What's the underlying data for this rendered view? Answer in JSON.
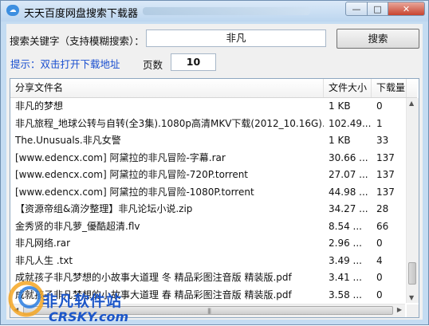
{
  "window": {
    "title": "天天百度网盘搜索下载器",
    "controls": {
      "minimize": "—",
      "maximize": "□",
      "close": "✕"
    }
  },
  "search": {
    "label": "搜索关键字（支持模糊搜索）：",
    "value": "非凡",
    "button": "搜索"
  },
  "hint": "提示：双击打开下载地址",
  "pages": {
    "label": "页数",
    "value": "10"
  },
  "table": {
    "columns": [
      "分享文件名",
      "文件大小",
      "下载量"
    ],
    "rows": [
      [
        "非凡的梦想",
        "1 KB",
        "0"
      ],
      [
        "非凡旅程_地球公转与自转(全3集).1080p高清MKV下载(2012_10.16G)...",
        "102.49...",
        "1"
      ],
      [
        "The.Unusuals.非凡女警",
        "1 KB",
        "33"
      ],
      [
        "[www.edencx.com] 阿黛拉的非凡冒险-字幕.rar",
        "30.66 ...",
        "137"
      ],
      [
        "[www.edencx.com] 阿黛拉的非凡冒险-720P.torrent",
        "27.07 ...",
        "137"
      ],
      [
        "[www.edencx.com] 阿黛拉的非凡冒险-1080P.torrent",
        "44.98 ...",
        "137"
      ],
      [
        "【资源帝组&滴汐整理】非凡论坛小说.zip",
        "34.27 ...",
        "28"
      ],
      [
        "金秀贤的非凡萝_優酷超清.flv",
        "8.54 ...",
        "66"
      ],
      [
        "非凡网络.rar",
        "2.96 ...",
        "0"
      ],
      [
        "非凡人生 .txt",
        "3.49 ...",
        "4"
      ],
      [
        "成就孩子非凡梦想的小故事大道理  冬  精品彩图注音版  精装版.pdf",
        "3.41 ...",
        "0"
      ],
      [
        "成就孩子非凡梦想的小故事大道理  春  精品彩图注音版  精装版.pdf",
        "3.58 ...",
        "0"
      ]
    ]
  },
  "watermark": {
    "main": "非凡软件站",
    "sub": "CRSKY.com"
  }
}
